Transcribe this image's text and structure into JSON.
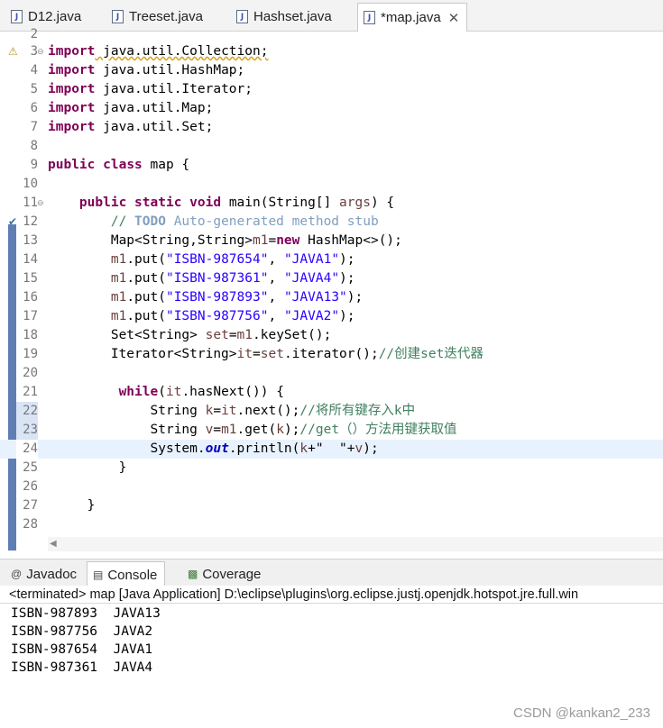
{
  "tabs": [
    {
      "label": "D12.java"
    },
    {
      "label": "Treeset.java"
    },
    {
      "label": "Hashset.java"
    },
    {
      "label": "*map.java"
    }
  ],
  "editor": {
    "lines": [
      {
        "num": "2"
      },
      {
        "num": "3"
      },
      {
        "num": "4"
      },
      {
        "num": "5"
      },
      {
        "num": "6"
      },
      {
        "num": "7"
      },
      {
        "num": "8"
      },
      {
        "num": "9"
      },
      {
        "num": "10"
      },
      {
        "num": "11"
      },
      {
        "num": "12"
      },
      {
        "num": "13"
      },
      {
        "num": "14"
      },
      {
        "num": "15"
      },
      {
        "num": "16"
      },
      {
        "num": "17"
      },
      {
        "num": "18"
      },
      {
        "num": "19"
      },
      {
        "num": "20"
      },
      {
        "num": "21"
      },
      {
        "num": "22"
      },
      {
        "num": "23"
      },
      {
        "num": "24"
      },
      {
        "num": "25"
      },
      {
        "num": "26"
      },
      {
        "num": "27"
      },
      {
        "num": "28"
      }
    ],
    "code": {
      "import_kw": "import",
      "imp3": " java.util.Collection;",
      "imp4": " java.util.HashMap;",
      "imp5": " java.util.Iterator;",
      "imp6": " java.util.Map;",
      "imp7": " java.util.Set;",
      "public_kw": "public",
      "class_kw": "class",
      "class_name": " map {",
      "static_kw": "static",
      "void_kw": "void",
      "main_sig": " main(String[] ",
      "args": "args",
      "main_end": ") {",
      "c12_prefix": "// ",
      "c12_todo": "TODO",
      "c12_text": " Auto-generated method stub",
      "l13_a": "Map<String,String>",
      "l13_var": "m1",
      "l13_b": "=",
      "new_kw": "new",
      "l13_c": " HashMap<>();",
      "put": ".put(",
      "m1": "m1",
      "comma": ", ",
      "close": ");",
      "k14": "\"ISBN-987654\"",
      "v14": "\"JAVA1\"",
      "k15": "\"ISBN-987361\"",
      "v15": "\"JAVA4\"",
      "k16": "\"ISBN-987893\"",
      "v16": "\"JAVA13\"",
      "k17": "\"ISBN-987756\"",
      "v17": "\"JAVA2\"",
      "l18_a": "Set<String> ",
      "set": "set",
      "l18_b": "=",
      "l18_c": ".keySet();",
      "l19_a": "Iterator<String>",
      "it": "it",
      "l19_b": "=",
      "l19_c": ".iterator();",
      "l19_cmt": "//创建set迭代器",
      "while_kw": "while",
      "l21_a": "(",
      "l21_b": ".hasNext()) {",
      "string": "String ",
      "k": "k",
      "l22_b": "=",
      "l22_c": ".next();",
      "l22_cmt": "//将所有键存入k中",
      "v": "v",
      "l23_b": "=",
      "l23_c": ".get(",
      "l23_d": ");",
      "l23_cmt": "//get（）方法用键获取值",
      "l24_a": "System.",
      "out": "out",
      "l24_b": ".println(",
      "l24_c": "+\"  \"+",
      "l24_d": ");",
      "brace": "}"
    }
  },
  "panel": {
    "tabs": [
      {
        "label": "Javadoc",
        "icon": "at-icon"
      },
      {
        "label": "Console",
        "icon": "console-icon"
      },
      {
        "label": "Coverage",
        "icon": "coverage-icon"
      }
    ],
    "status": "<terminated> map [Java Application] D:\\eclipse\\plugins\\org.eclipse.justj.openjdk.hotspot.jre.full.win",
    "output": [
      "ISBN-987893  JAVA13",
      "ISBN-987756  JAVA2",
      "ISBN-987654  JAVA1",
      "ISBN-987361  JAVA4"
    ]
  },
  "watermark": "CSDN @kankan2_233"
}
